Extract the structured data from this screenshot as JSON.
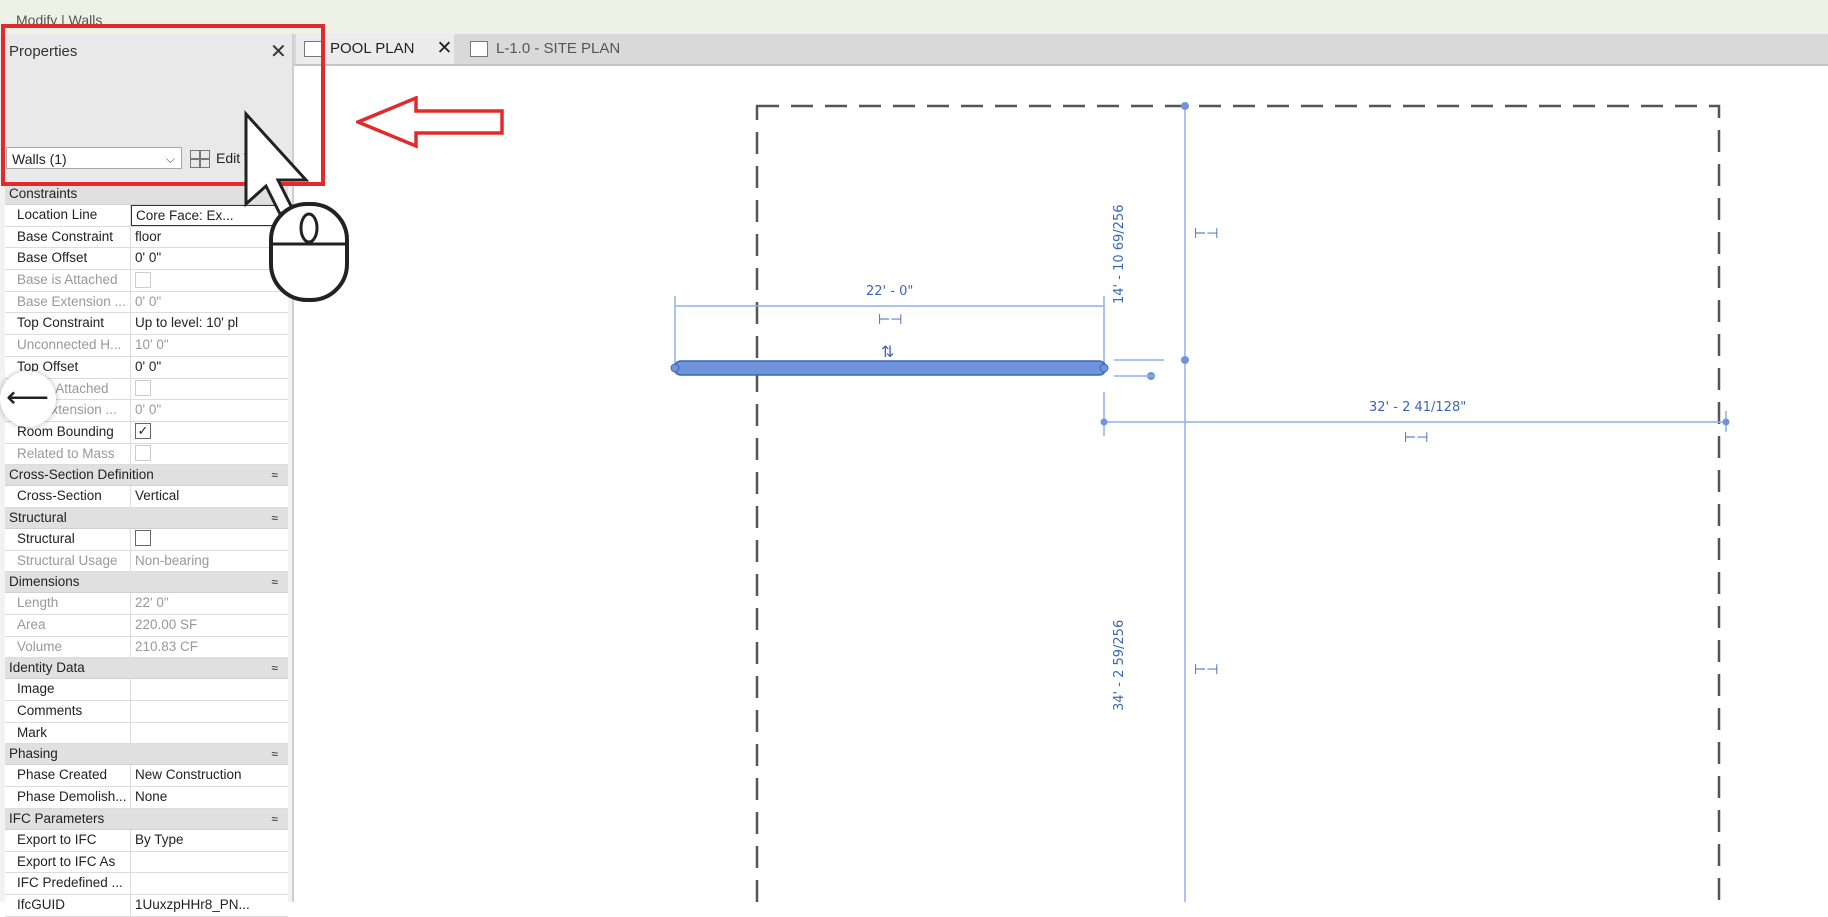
{
  "ribbon": {
    "context_label": "Modify | Walls"
  },
  "properties": {
    "title": "Properties",
    "type_selector": "Walls (1)",
    "edit_type": "Edit Type",
    "groups": [
      {
        "name": "Constraints",
        "rows": [
          {
            "k": "Location Line",
            "v": "Core Face: Ex...",
            "dim": false,
            "editing": true
          },
          {
            "k": "Base Constraint",
            "v": "floor",
            "dim": false
          },
          {
            "k": "Base Offset",
            "v": "0'  0\"",
            "dim": false
          },
          {
            "k": "Base is Attached",
            "v": "",
            "dim": true,
            "checkbox": "empty"
          },
          {
            "k": "Base Extension ...",
            "v": "0'  0\"",
            "dim": true
          },
          {
            "k": "Top Constraint",
            "v": "Up to level: 10' pl",
            "dim": false
          },
          {
            "k": "Unconnected H...",
            "v": "10'  0\"",
            "dim": true
          },
          {
            "k": "Top Offset",
            "v": "0'  0\"",
            "dim": false
          },
          {
            "k": "Top is Attached",
            "v": "",
            "dim": true,
            "checkbox": "empty"
          },
          {
            "k": "Top Extension ...",
            "v": "0'  0\"",
            "dim": true
          },
          {
            "k": "Room Bounding",
            "v": "",
            "dim": false,
            "checkbox": "checked"
          },
          {
            "k": "Related to Mass",
            "v": "",
            "dim": true,
            "checkbox": "empty"
          }
        ]
      },
      {
        "name": "Cross-Section Definition",
        "rows": [
          {
            "k": "Cross-Section",
            "v": "Vertical",
            "dim": false
          }
        ]
      },
      {
        "name": "Structural",
        "rows": [
          {
            "k": "Structural",
            "v": "",
            "dim": false,
            "checkbox": "empty"
          },
          {
            "k": "Structural Usage",
            "v": "Non-bearing",
            "dim": true
          }
        ]
      },
      {
        "name": "Dimensions",
        "rows": [
          {
            "k": "Length",
            "v": "22'  0\"",
            "dim": true
          },
          {
            "k": "Area",
            "v": "220.00 SF",
            "dim": true
          },
          {
            "k": "Volume",
            "v": "210.83 CF",
            "dim": true
          }
        ]
      },
      {
        "name": "Identity Data",
        "rows": [
          {
            "k": "Image",
            "v": "",
            "dim": false
          },
          {
            "k": "Comments",
            "v": "",
            "dim": false
          },
          {
            "k": "Mark",
            "v": "",
            "dim": false
          }
        ]
      },
      {
        "name": "Phasing",
        "rows": [
          {
            "k": "Phase Created",
            "v": "New Construction",
            "dim": false
          },
          {
            "k": "Phase Demolish...",
            "v": "None",
            "dim": false
          }
        ]
      },
      {
        "name": "IFC Parameters",
        "rows": [
          {
            "k": "Export to IFC",
            "v": "By Type",
            "dim": false
          },
          {
            "k": "Export to IFC As",
            "v": "",
            "dim": false
          },
          {
            "k": "IFC Predefined ...",
            "v": "",
            "dim": false
          },
          {
            "k": "IfcGUID",
            "v": "1UuxzpHHr8_PN...",
            "dim": false
          }
        ]
      }
    ]
  },
  "tabs": [
    {
      "label": "POOL PLAN",
      "active": true
    },
    {
      "label": "L-1.0 - SITE PLAN",
      "active": false
    }
  ],
  "drawing": {
    "dim_horizontal_wall": "22' - 0\"",
    "dim_horizontal_right": "32' - 2 41/128\"",
    "dim_vertical_top": "14' - 10 69/256",
    "dim_vertical_bottom": "34' - 2 59/256"
  },
  "colors": {
    "annotation": "#e32a2a",
    "wall": "#6f94dc",
    "dimension": "#3a66b8"
  }
}
